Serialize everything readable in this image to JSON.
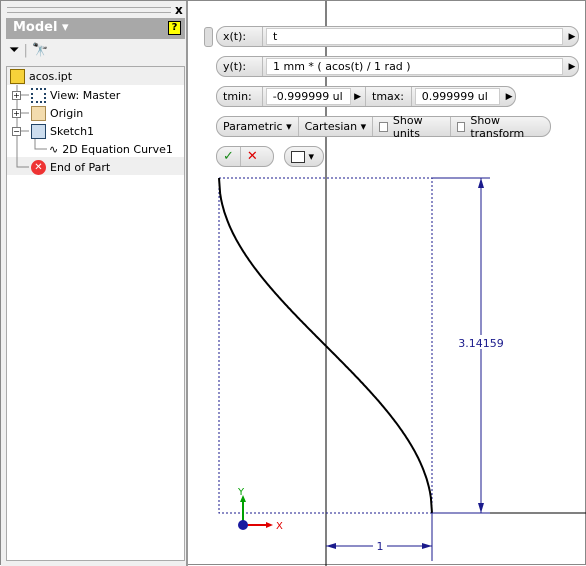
{
  "panel": {
    "title": "Model",
    "help_icon": "help-icon",
    "close": "x"
  },
  "tree": {
    "items": [
      {
        "label": "acos.ipt",
        "icon": "part-icon"
      },
      {
        "label": "View: Master",
        "icon": "view-icon"
      },
      {
        "label": "Origin",
        "icon": "folder-icon"
      },
      {
        "label": "Sketch1",
        "icon": "sketch-icon"
      },
      {
        "label": "2D Equation Curve1",
        "icon": "equation-curve-icon"
      },
      {
        "label": "End of Part",
        "icon": "end-of-part-icon"
      }
    ]
  },
  "editor": {
    "x_label": "x(t):",
    "x_value": "t",
    "y_label": "y(t):",
    "y_value": "1 mm * ( acos(t) / 1 rad )",
    "tmin_label": "tmin:",
    "tmin_value": "-0.999999 ul",
    "tmax_label": "tmax:",
    "tmax_value": "0.999999 ul",
    "type": "Parametric",
    "coords": "Cartesian",
    "show_units": "Show units",
    "show_transform": "Show transform"
  },
  "sketch": {
    "height_dim": "3.14159",
    "width_dim": "1",
    "axis_x": "X",
    "axis_y": "Y",
    "colors": {
      "curve": "#000000",
      "dimension": "#1a1a8c",
      "x_axis": "#e00000",
      "y_axis": "#00a000"
    }
  }
}
